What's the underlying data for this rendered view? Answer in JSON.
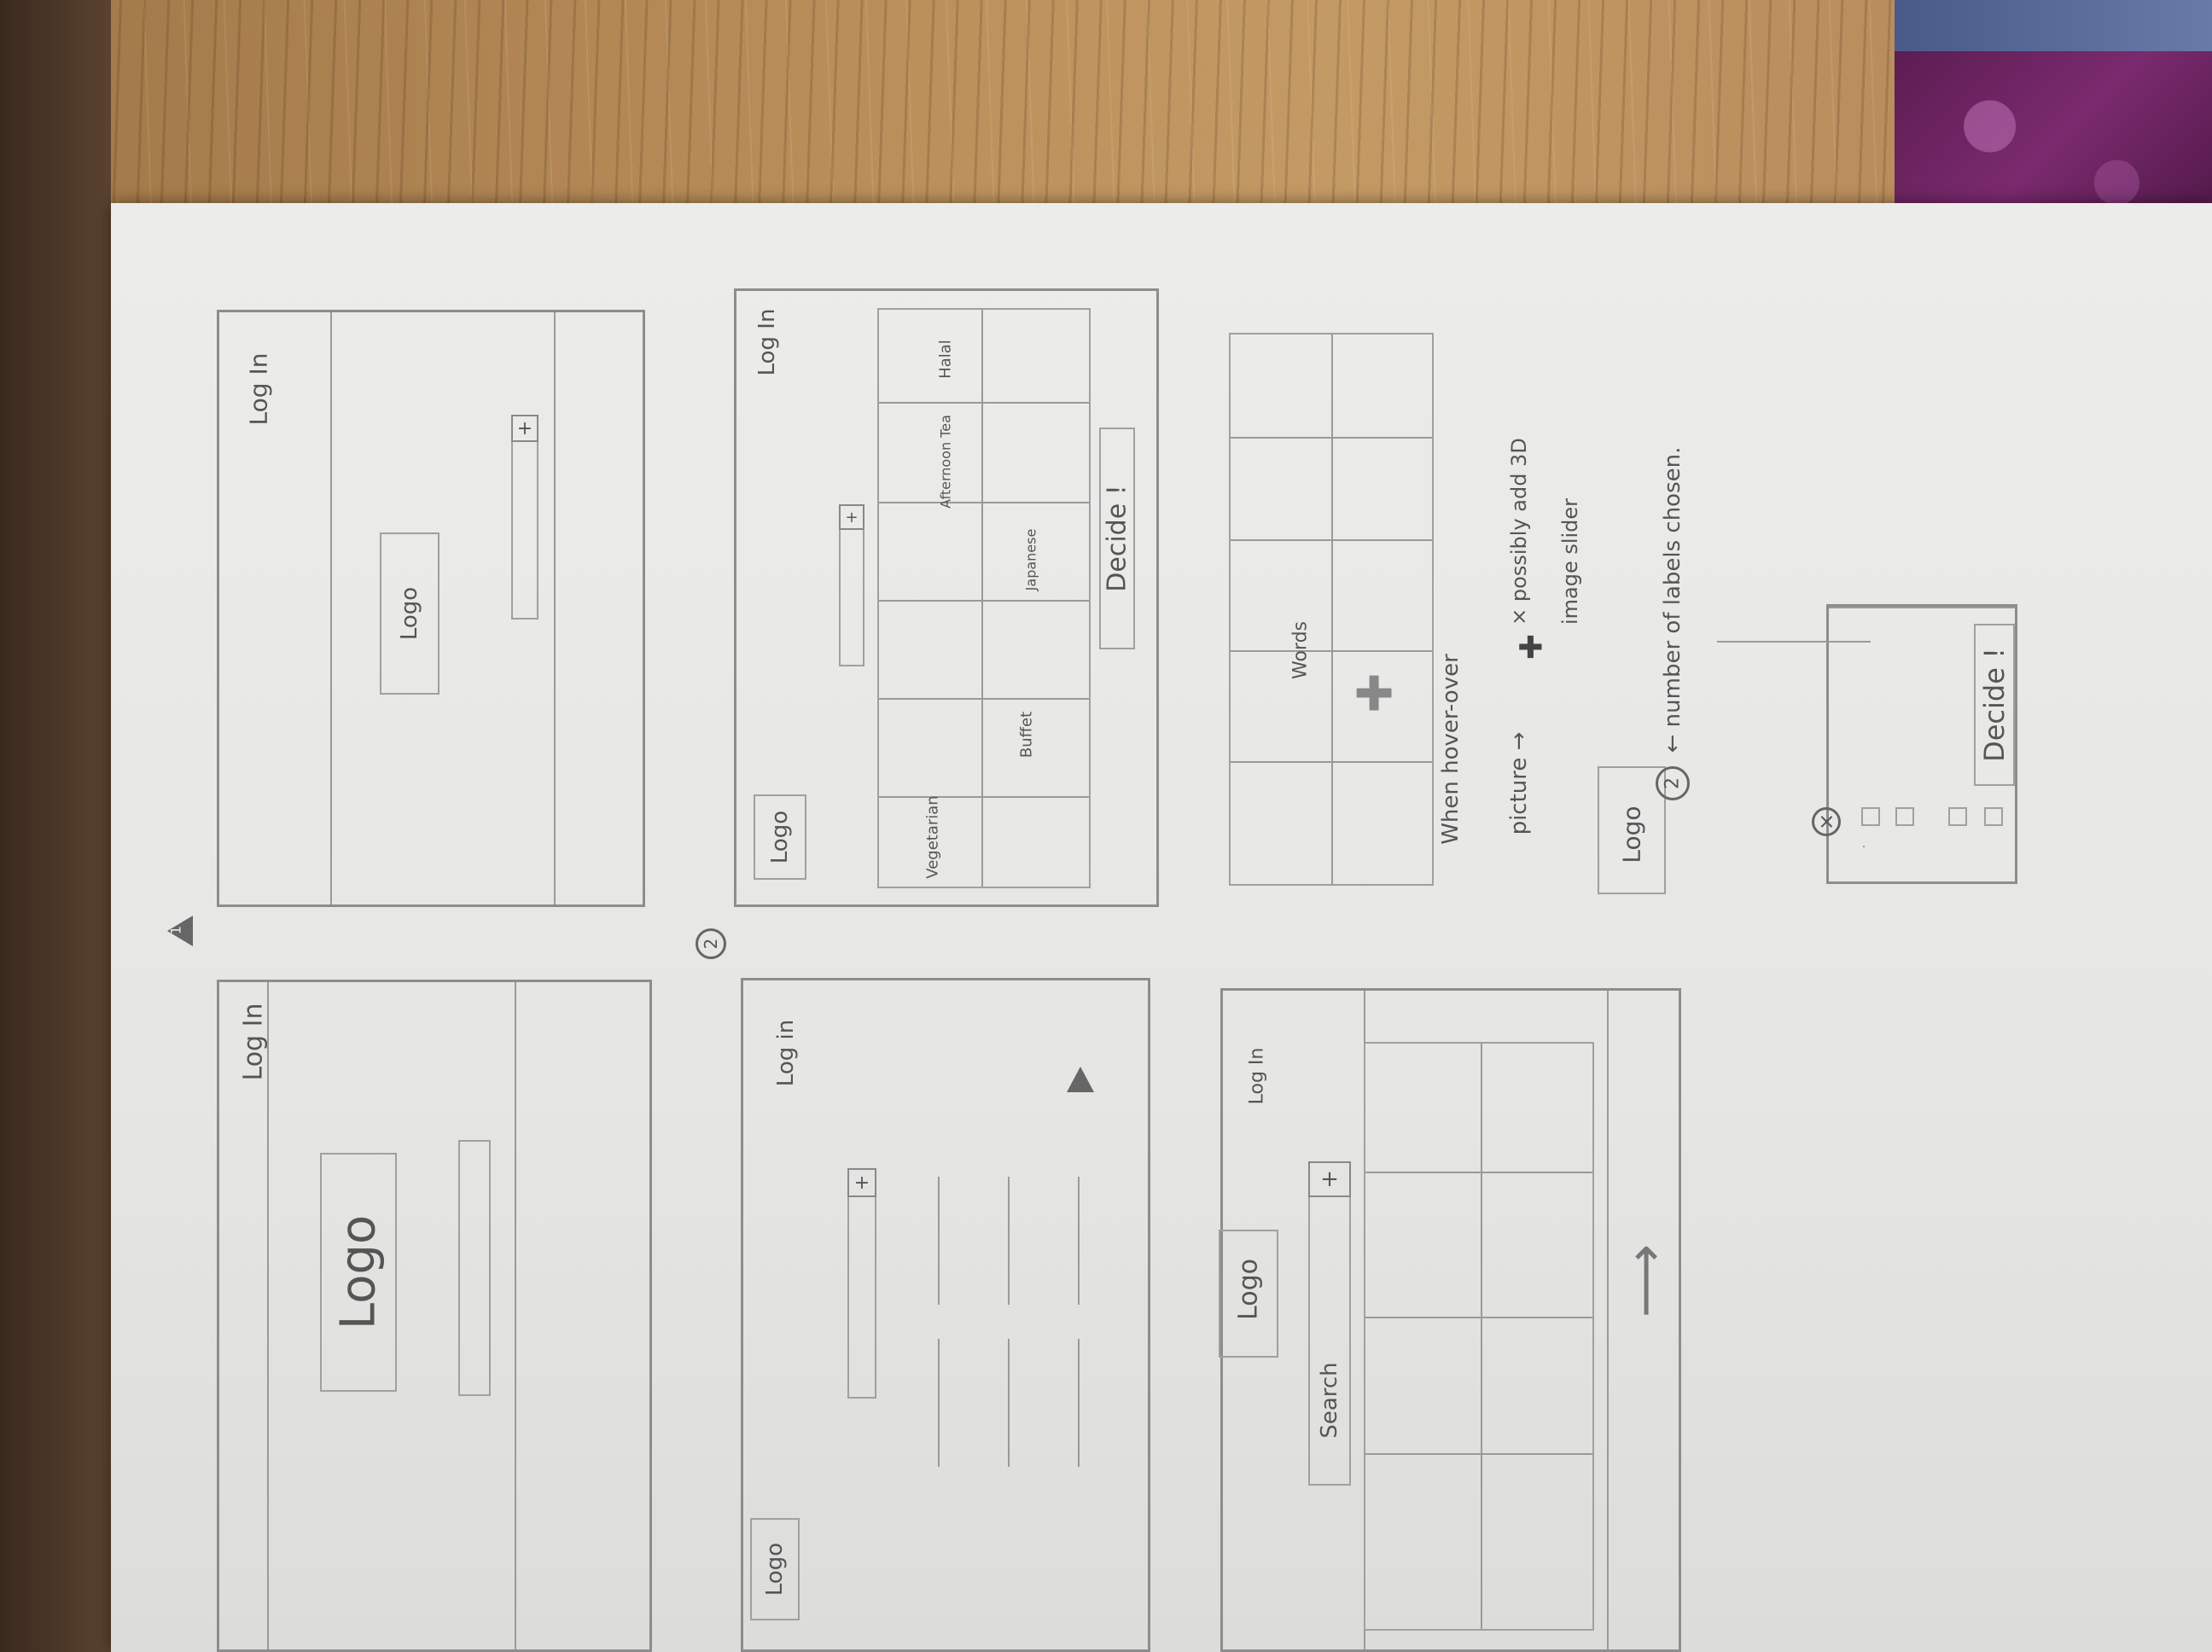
{
  "sketch": {
    "frame1": {
      "number": "1",
      "login": "Log In",
      "logo": "Logo",
      "plus": "+"
    },
    "frame2": {
      "login": "Log In",
      "logo": "Logo",
      "plus": "+"
    },
    "frame3": {
      "number": "2",
      "login": "Log In",
      "logo": "Logo",
      "plus": "+",
      "labels": [
        "Vegetarian",
        "Buffet",
        "Japanese",
        "Afternoon Tea",
        "Halal"
      ],
      "decide": "Decide !"
    },
    "frame4": {
      "login": "Log in",
      "logo": "Logo",
      "plus": "+"
    },
    "frame5": {
      "words": "Words"
    },
    "frame6": {
      "login": "Log In",
      "logo": "Logo",
      "search": "Search",
      "plus": "+"
    },
    "notes": {
      "hover_line1": "When hover-over",
      "hover_line2": "picture →",
      "slider_line1": "× possibly add 3D",
      "slider_line2": "image slider",
      "count_number": "2",
      "count_text": "← number of labels chosen.",
      "logo": "Logo"
    },
    "popup": {
      "close": "×",
      "decide": "Decide !"
    }
  }
}
